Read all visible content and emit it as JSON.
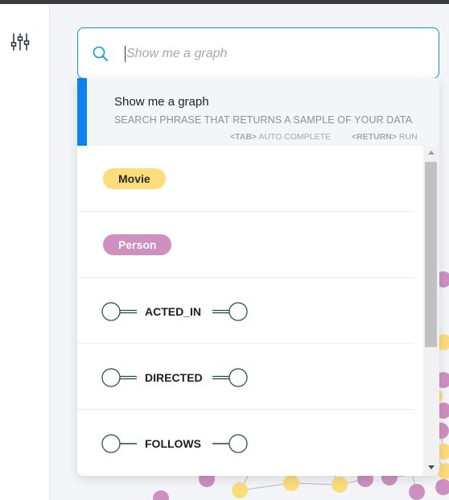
{
  "search": {
    "placeholder": "Show me a graph"
  },
  "suggestion": {
    "title": "Show me a graph",
    "description": "SEARCH PHRASE THAT RETURNS A SAMPLE OF YOUR DATA",
    "hint_tab_key": "<TAB>",
    "hint_tab_text": " AUTO COMPLETE",
    "hint_return_key": "<RETURN>",
    "hint_return_text": " RUN"
  },
  "labels": [
    {
      "name": "Movie",
      "color": "#fddc7a"
    },
    {
      "name": "Person",
      "color": "#cd90c1"
    }
  ],
  "relationships": [
    {
      "name": "ACTED_IN",
      "double_line": true
    },
    {
      "name": "DIRECTED",
      "double_line": true
    },
    {
      "name": "FOLLOWS",
      "double_line": false
    }
  ],
  "colors": {
    "accent": "#0a82f0",
    "search_border": "#0a99e6",
    "movie_node": "#fddc7a",
    "person_node": "#cd90c1",
    "edge": "#b7bac2",
    "rel_icon": "#1f4a4a"
  },
  "icons": {
    "sidebar_filter": "sliders-icon",
    "search": "magnifier-icon"
  }
}
